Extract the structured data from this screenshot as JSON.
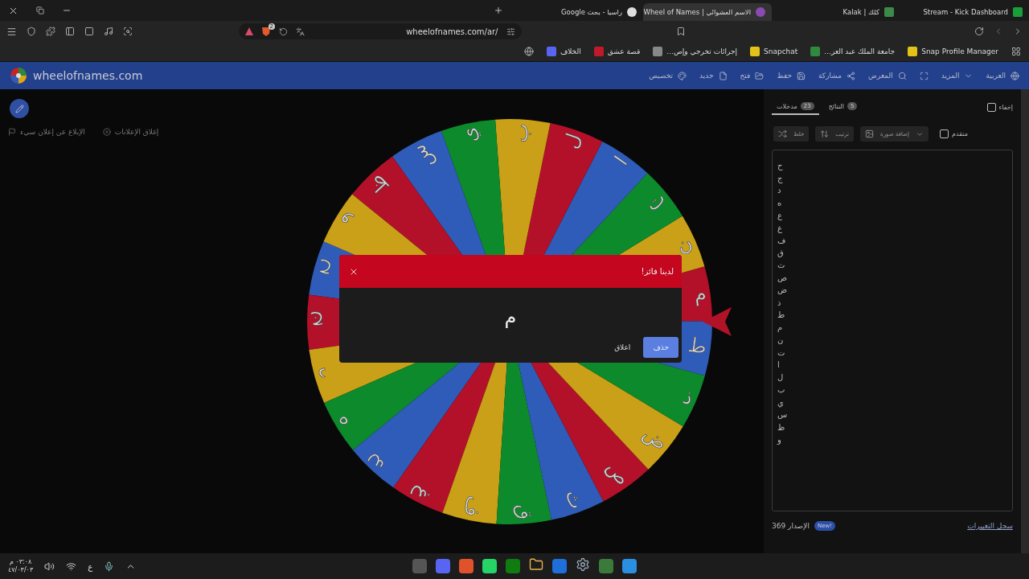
{
  "browser": {
    "tabs": [
      {
        "title": "Stream - Kick Dashboard",
        "selected": false
      },
      {
        "title": "كلك | Kalak",
        "selected": false
      },
      {
        "title": "الاسم العشوائي | Wheel of Names",
        "selected": true
      },
      {
        "title": "راسيا - بحث Google",
        "selected": false
      }
    ],
    "address": "wheelofnames.com/ar/",
    "shield_badge": "2",
    "bookmarks": [
      "Snap Profile Manager",
      "جامعة الملك عبد العز...",
      "Snapchat",
      "إجرائات تخرجي وإص...",
      "قصة عشق",
      "الخلاف"
    ]
  },
  "site": {
    "logo": "wheelofnames.com",
    "menu": [
      {
        "kind": "text",
        "label": "العربية"
      },
      {
        "kind": "text",
        "label": "المزيد"
      },
      {
        "kind": "icon"
      },
      {
        "kind": "text",
        "label": "المعرض"
      },
      {
        "kind": "text",
        "label": "مشاركة"
      },
      {
        "kind": "text",
        "label": "حفظ"
      },
      {
        "kind": "text",
        "label": "فتح"
      },
      {
        "kind": "text",
        "label": "جديد"
      },
      {
        "kind": "text",
        "label": "تخصيص"
      }
    ]
  },
  "ads": {
    "close": "إغلاق الإعلانات",
    "report": "الإبلاغ عن إعلان سيء"
  },
  "wheel": {
    "segments": [
      {
        "label": "ح",
        "color": "#2f5cb8"
      },
      {
        "label": "ج",
        "color": "#b3102a"
      },
      {
        "label": "د",
        "color": "#c9a017"
      },
      {
        "label": "ه",
        "color": "#0d8a2c"
      },
      {
        "label": "ع",
        "color": "#2f5cb8"
      },
      {
        "label": "غ",
        "color": "#b3102a"
      },
      {
        "label": "ف",
        "color": "#c9a017"
      },
      {
        "label": "ق",
        "color": "#0d8a2c"
      },
      {
        "label": "ث",
        "color": "#2f5cb8"
      },
      {
        "label": "ص",
        "color": "#b3102a"
      },
      {
        "label": "ض",
        "color": "#c9a017"
      },
      {
        "label": "ذ",
        "color": "#0d8a2c"
      },
      {
        "label": "ط",
        "color": "#2f5cb8"
      },
      {
        "label": "م",
        "color": "#b3102a"
      },
      {
        "label": "ن",
        "color": "#c9a017"
      },
      {
        "label": "ت",
        "color": "#0d8a2c"
      },
      {
        "label": "ا",
        "color": "#2f5cb8"
      },
      {
        "label": "ل",
        "color": "#b3102a"
      },
      {
        "label": "ب",
        "color": "#c9a017"
      },
      {
        "label": "ي",
        "color": "#0d8a2c"
      },
      {
        "label": "س",
        "color": "#2f5cb8"
      },
      {
        "label": "ظ",
        "color": "#b3102a"
      },
      {
        "label": "و",
        "color": "#c9a017"
      }
    ]
  },
  "dialog": {
    "title": "لدينا فائز!",
    "winner": "م",
    "buttons": [
      {
        "label": "حذف",
        "kind": "primary"
      },
      {
        "label": "اعلاق",
        "kind": "plain"
      }
    ]
  },
  "panel": {
    "hide": {
      "label": "إخفاء",
      "checked": false
    },
    "tabs": [
      {
        "label": "النتائج",
        "count": "5",
        "selected": false
      },
      {
        "label": "مدخلات",
        "count": "23",
        "selected": true
      }
    ],
    "tools": [
      {
        "label": "ترتيب"
      },
      {
        "label": "خلط"
      }
    ],
    "add_image": "إضافة صورة",
    "advanced": {
      "label": "متقدم",
      "checked": false
    },
    "entries": [
      "ح",
      "ج",
      "د",
      "ه",
      "ع",
      "غ",
      "ف",
      "ق",
      "ث",
      "ص",
      "ض",
      "ذ",
      "ط",
      "م",
      "ن",
      "ت",
      "ا",
      "ل",
      "ب",
      "ي",
      "س",
      "ظ",
      "و"
    ],
    "version": "الإصدار 369",
    "badge": "New!",
    "changelog": "سجل التغييرات"
  },
  "taskbar": {
    "time": "٠٣:٠٨ م",
    "date": "٤٧/٠٣/٠٣",
    "language": "ع"
  }
}
